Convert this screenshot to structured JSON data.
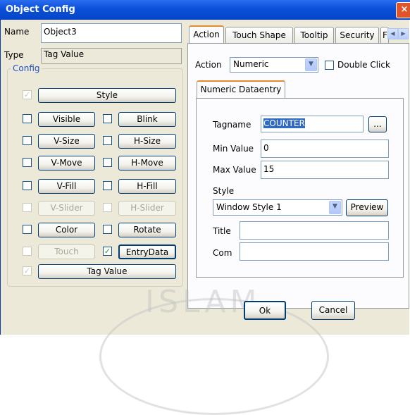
{
  "window": {
    "title": "Object Config",
    "close_label": "×"
  },
  "left": {
    "name_label": "Name",
    "name_value": "Object3",
    "type_label": "Type",
    "type_value": "Tag Value",
    "config_label": "Config",
    "style_button": "Style",
    "rows": [
      {
        "left": "Visible",
        "right": "Blink"
      },
      {
        "left": "V-Size",
        "right": "H-Size"
      },
      {
        "left": "V-Move",
        "right": "H-Move"
      },
      {
        "left": "V-Fill",
        "right": "H-Fill"
      },
      {
        "left": "V-Slider",
        "right": "H-Slider"
      },
      {
        "left": "Color",
        "right": "Rotate"
      },
      {
        "left": "Touch",
        "right": "EntryData"
      }
    ],
    "tag_value_button": "Tag Value"
  },
  "tabs": [
    "Action",
    "Touch Shape",
    "Tooltip",
    "Security",
    "F"
  ],
  "action": {
    "action_label": "Action",
    "action_value": "Numeric",
    "double_click_label": "Double Click",
    "subtab": "Numeric Dataentry",
    "tagname_label": "Tagname",
    "tagname_value": "COUNTER",
    "browse_label": "...",
    "min_label": "Min Value",
    "min_value": "0",
    "max_label": "Max Value",
    "max_value": "15",
    "style_label": "Style",
    "style_value": "Window Style 1",
    "preview_label": "Preview",
    "title_label": "Title",
    "title_value": "",
    "com_label": "Com",
    "com_value": ""
  },
  "buttons": {
    "ok": "Ok",
    "cancel": "Cancel"
  },
  "watermark": "ISLAM"
}
